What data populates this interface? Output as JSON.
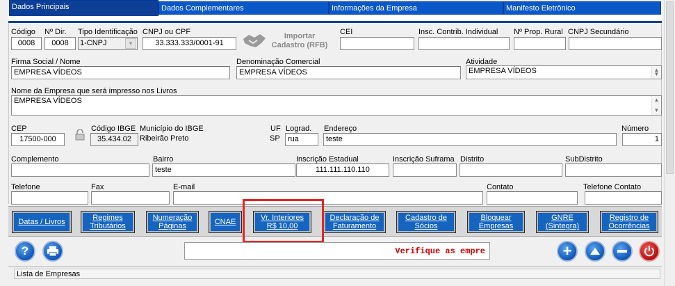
{
  "tabs": [
    "Dados Principais",
    "Dados Complementares",
    "Informações da Empresa",
    "Manifesto Eletrônico"
  ],
  "row1": {
    "codigo_label": "Código",
    "codigo": "0008",
    "ndir_label": "Nº Dir.",
    "ndir": "0008",
    "tipo_label": "Tipo Identificação",
    "tipo": "1-CNPJ",
    "cnpj_label": "CNPJ ou CPF",
    "cnpj": "33.333.333/0001-91",
    "importar_label": "Importar Cadastro (RFB)",
    "cei_label": "CEI",
    "cei": "",
    "insc_label": "Insc. Contrib. Individual",
    "insc": "",
    "prop_label": "Nº Prop. Rural",
    "prop": "",
    "cnpj2_label": "CNPJ Secundário",
    "cnpj2": ""
  },
  "row2": {
    "firma_label": "Firma Social / Nome",
    "firma": "EMPRESA VÍDEOS",
    "denom_label": "Denominação Comercial",
    "denom": "EMPRESA VÍDEOS",
    "ativ_label": "Atividade",
    "ativ": "EMPRESA VÍDEOS"
  },
  "row3": {
    "livros_label": "Nome da Empresa que será impresso nos Livros",
    "livros": "EMPRESA VÍDEOS"
  },
  "row4": {
    "cep_label": "CEP",
    "cep": "17500-000",
    "ibge_label": "Código IBGE",
    "ibge": "35.434.02",
    "mun_label": "Município do IBGE",
    "mun": "Ribeirão Preto",
    "uf_label": "UF",
    "uf": "SP",
    "lograd_label": "Lograd.",
    "lograd": "rua",
    "end_label": "Endereço",
    "end": "teste",
    "num_label": "Número",
    "num": "1"
  },
  "row5": {
    "compl_label": "Complemento",
    "compl": "",
    "bairro_label": "Bairro",
    "bairro": "teste",
    "ie_label": "Inscrição Estadual",
    "ie": "111.111.110.110",
    "suf_label": "Inscrição Suframa",
    "suf": "",
    "dist_label": "Distrito",
    "dist": "",
    "subd_label": "SubDistrito",
    "subd": ""
  },
  "row6": {
    "tel_label": "Telefone",
    "tel": "",
    "fax_label": "Fax",
    "fax": "",
    "email_label": "E-mail",
    "email": "",
    "contato_label": "Contato",
    "contato": "",
    "telc_label": "Telefone Contato",
    "telc": ""
  },
  "buttons": [
    [
      "Datas / Livros"
    ],
    [
      "Regimes",
      "Tributários"
    ],
    [
      "Numeração",
      "Páginas"
    ],
    [
      "CNAE"
    ],
    [
      "Vr. Interiores",
      "R$ 10,00"
    ],
    [
      "Declaração de",
      "Faturamento"
    ],
    [
      "Cadastro de",
      "Sócios"
    ],
    [
      "Bloquear",
      "Empresas"
    ],
    [
      "GNRE",
      "(Sintegra)"
    ],
    [
      "Registro de",
      "Ocorrências"
    ]
  ],
  "message": "Verifique as empre",
  "status": "Lista de Empresas",
  "colors": {
    "tab_blue": "#0a58c8",
    "tab_active": "#0e3f96",
    "button_blue": "#1565c0",
    "highlight": "#e32626",
    "message_red": "#d00000"
  }
}
